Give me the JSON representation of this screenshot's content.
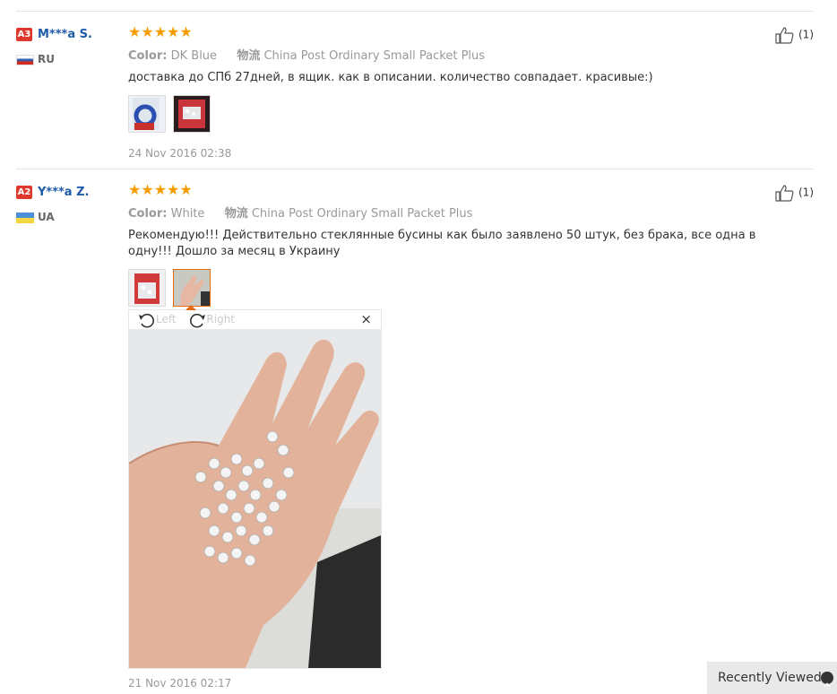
{
  "reviews": [
    {
      "level": "A3",
      "username": "M***a S.",
      "country": "RU",
      "stars": "★★★★★",
      "color_label": "Color:",
      "color_value": "DK Blue",
      "shipping_label": "物流",
      "shipping_value": "China Post Ordinary Small Packet Plus",
      "text": "доставка до СПб 27дней, в ящик. как в описании. количество совпадает. красивые:)",
      "date": "24 Nov 2016 02:38",
      "likes": "(1)"
    },
    {
      "level": "A2",
      "username": "Y***a Z.",
      "country": "UA",
      "stars": "★★★★★",
      "color_label": "Color:",
      "color_value": "White",
      "shipping_label": "物流",
      "shipping_value": "China Post Ordinary Small Packet Plus",
      "text": "Рекомендую!!! Действительно стеклянные бусины как было заявлено 50 штук, без брака, все одна в одну!!! Дошло за месяц в Украину",
      "date": "21 Nov 2016 02:17",
      "likes": "(1)"
    }
  ],
  "viewer": {
    "rotate_left": "Left",
    "rotate_right": "Right",
    "close": "×"
  },
  "recently_viewed": "Recently Viewed",
  "colors": {
    "accent_orange": "#e86a10",
    "star": "#f59d00",
    "link_blue": "#1e5aa8",
    "badge_red": "#e0382d"
  }
}
